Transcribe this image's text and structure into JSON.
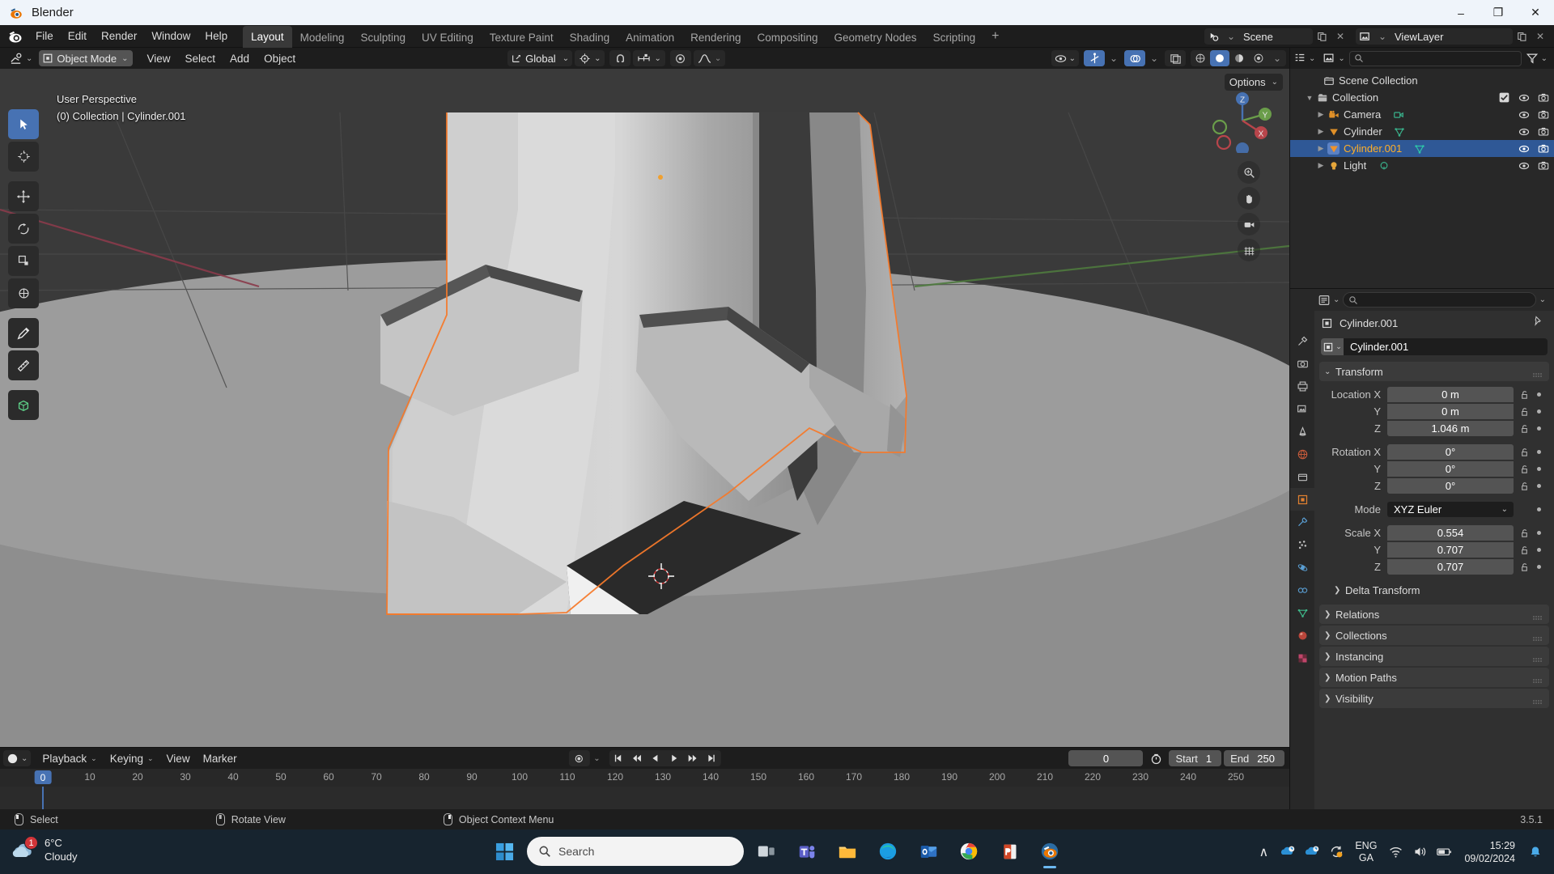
{
  "window": {
    "title": "Blender",
    "app_icon": "blender-logo-icon",
    "minimize": "–",
    "maximize": "❐",
    "close": "✕"
  },
  "topbar": {
    "menus": [
      "File",
      "Edit",
      "Render",
      "Window",
      "Help"
    ],
    "workspaces": [
      {
        "label": "Layout",
        "active": true
      },
      {
        "label": "Modeling",
        "active": false
      },
      {
        "label": "Sculpting",
        "active": false
      },
      {
        "label": "UV Editing",
        "active": false
      },
      {
        "label": "Texture Paint",
        "active": false
      },
      {
        "label": "Shading",
        "active": false
      },
      {
        "label": "Animation",
        "active": false
      },
      {
        "label": "Rendering",
        "active": false
      },
      {
        "label": "Compositing",
        "active": false
      },
      {
        "label": "Geometry Nodes",
        "active": false
      },
      {
        "label": "Scripting",
        "active": false
      }
    ],
    "add_workspace": "+",
    "scene_name": "Scene",
    "view_layer_name": "ViewLayer",
    "new_scene_icon": "duplicate-icon",
    "remove_scene_icon": "close-icon",
    "new_layer_icon": "duplicate-icon",
    "remove_layer_icon": "close-icon"
  },
  "viewport": {
    "mode": "Object Mode",
    "menus": [
      "View",
      "Select",
      "Add",
      "Object"
    ],
    "transform_orientation": "Global",
    "snap_icon": "magnet-icon",
    "proportional_icon": "proportional-editing-icon",
    "options_label": "Options",
    "overlay_line1": "User Perspective",
    "overlay_line2": "(0) Collection | Cylinder.001",
    "tools": [
      {
        "name": "tweak-tool",
        "active": true
      },
      {
        "name": "cursor-tool",
        "active": false
      },
      {
        "name": "move-tool",
        "active": false
      },
      {
        "name": "rotate-tool",
        "active": false
      },
      {
        "name": "scale-tool",
        "active": false
      },
      {
        "name": "transform-tool",
        "active": false
      },
      {
        "name": "annotate-tool",
        "active": false
      },
      {
        "name": "measure-tool",
        "active": false
      },
      {
        "name": "add-cube-tool",
        "active": false
      }
    ],
    "gizmo_axes": [
      "X",
      "Y",
      "Z"
    ],
    "nav_buttons": [
      "zoom-icon",
      "pan-hand-icon",
      "camera-view-icon",
      "toggle-ortho-icon"
    ],
    "shading_modes": [
      "wireframe",
      "solid",
      "material",
      "rendered"
    ],
    "active_shading": "solid"
  },
  "outliner": {
    "display_mode_icon": "outliner-icon",
    "filter_icon": "funnel-icon",
    "search_placeholder": "",
    "rows": [
      {
        "name": "Scene Collection",
        "icon": "scene-collection-icon",
        "indent": 0,
        "disclosure": "",
        "selected": false,
        "checkbox": false,
        "eye": false,
        "camera": false
      },
      {
        "name": "Collection",
        "icon": "collection-icon",
        "indent": 1,
        "disclosure": "▼",
        "selected": false,
        "checkbox": true,
        "eye": true,
        "camera": true
      },
      {
        "name": "Camera",
        "icon": "camera-data-icon",
        "indent": 2,
        "disclosure": "▶",
        "selected": false,
        "checkbox": false,
        "eye": true,
        "camera": true,
        "data_icon": "camera-object-icon"
      },
      {
        "name": "Cylinder",
        "icon": "mesh-data-icon",
        "indent": 2,
        "disclosure": "▶",
        "selected": false,
        "checkbox": false,
        "eye": true,
        "camera": true,
        "data_icon": "mesh-tri-icon"
      },
      {
        "name": "Cylinder.001",
        "icon": "mesh-data-icon",
        "indent": 2,
        "disclosure": "▶",
        "selected": true,
        "checkbox": false,
        "eye": true,
        "camera": true,
        "data_icon": "mesh-tri-icon"
      },
      {
        "name": "Light",
        "icon": "light-data-icon",
        "indent": 2,
        "disclosure": "▶",
        "selected": false,
        "checkbox": false,
        "eye": true,
        "camera": true,
        "data_icon": "light-bulb-icon"
      }
    ]
  },
  "properties": {
    "search_placeholder": "",
    "breadcrumb_object": "Cylinder.001",
    "pin_icon": "pin-icon",
    "object_name_field": "Cylinder.001",
    "tabs": [
      {
        "name": "tool-tab",
        "icon": "tool-icon",
        "active": false
      },
      {
        "name": "render-tab",
        "icon": "camera-back-icon",
        "active": false
      },
      {
        "name": "output-tab",
        "icon": "printer-icon",
        "active": false
      },
      {
        "name": "view-layer-tab",
        "icon": "images-icon",
        "active": false
      },
      {
        "name": "scene-tab",
        "icon": "cone-icon",
        "active": false
      },
      {
        "name": "world-tab",
        "icon": "globe-icon",
        "active": false
      },
      {
        "name": "collection-tab",
        "icon": "box-icon",
        "active": false
      },
      {
        "name": "object-tab",
        "icon": "square-orange-icon",
        "active": true
      },
      {
        "name": "modifiers-tab",
        "icon": "wrench-icon",
        "active": false
      },
      {
        "name": "particles-tab",
        "icon": "particles-icon",
        "active": false
      },
      {
        "name": "physics-tab",
        "icon": "physics-icon",
        "active": false
      },
      {
        "name": "constraints-tab",
        "icon": "constraint-icon",
        "active": false
      },
      {
        "name": "data-tab",
        "icon": "green-triangle-icon",
        "active": false
      },
      {
        "name": "material-tab",
        "icon": "material-sphere-icon",
        "active": false
      },
      {
        "name": "texture-tab",
        "icon": "checker-icon",
        "active": false
      }
    ],
    "transform_panel": {
      "title": "Transform",
      "groups": [
        {
          "label": "Location",
          "rows": [
            {
              "axis": "Location X",
              "value": "0 m"
            },
            {
              "axis": "Y",
              "value": "0 m"
            },
            {
              "axis": "Z",
              "value": "1.046 m"
            }
          ]
        },
        {
          "label": "Rotation",
          "rows": [
            {
              "axis": "Rotation X",
              "value": "0°"
            },
            {
              "axis": "Y",
              "value": "0°"
            },
            {
              "axis": "Z",
              "value": "0°"
            }
          ]
        }
      ],
      "mode_label": "Mode",
      "mode_value": "XYZ Euler",
      "scale_rows": [
        {
          "axis": "Scale X",
          "value": "0.554"
        },
        {
          "axis": "Y",
          "value": "0.707"
        },
        {
          "axis": "Z",
          "value": "0.707"
        }
      ],
      "delta_transform": "Delta Transform"
    },
    "collapsed_panels": [
      "Relations",
      "Collections",
      "Instancing",
      "Motion Paths",
      "Visibility"
    ]
  },
  "timeline": {
    "editor_icon": "timeline-icon",
    "menus": [
      "Playback",
      "Keying",
      "View",
      "Marker"
    ],
    "record_icon": "record-icon",
    "playback_buttons": [
      "jump-start-icon",
      "prev-keyframe-icon",
      "play-reverse-icon",
      "play-icon",
      "next-keyframe-icon",
      "jump-end-icon"
    ],
    "current_frame": "0",
    "use_preview_range_icon": "stopwatch-icon",
    "start_label": "Start",
    "start_value": "1",
    "end_label": "End",
    "end_value": "250",
    "ticks": [
      0,
      10,
      20,
      30,
      40,
      50,
      60,
      70,
      80,
      90,
      100,
      110,
      120,
      130,
      140,
      150,
      160,
      170,
      180,
      190,
      200,
      210,
      220,
      230,
      240,
      250
    ],
    "playhead_frame": 0
  },
  "statusbar": {
    "items": [
      {
        "icon": "mouse-left-icon",
        "label": "Select"
      },
      {
        "icon": "mouse-middle-icon",
        "label": "Rotate View"
      },
      {
        "icon": "mouse-right-icon",
        "label": "Object Context Menu"
      }
    ],
    "version": "3.5.1"
  },
  "taskbar": {
    "weather_temp": "6°C",
    "weather_desc": "Cloudy",
    "weather_badge": "1",
    "start_icon": "windows-logo-icon",
    "search_placeholder": "Search",
    "apps": [
      {
        "name": "task-view-icon",
        "active": false
      },
      {
        "name": "microsoft-teams-icon",
        "active": false
      },
      {
        "name": "file-explorer-icon",
        "active": false
      },
      {
        "name": "microsoft-edge-icon",
        "active": false
      },
      {
        "name": "outlook-icon",
        "active": false
      },
      {
        "name": "google-chrome-icon",
        "active": false
      },
      {
        "name": "powerpoint-icon",
        "active": false
      },
      {
        "name": "blender-taskbar-icon",
        "active": true
      }
    ],
    "tray_chevron": "∧",
    "tray_icons": [
      "onedrive-icon",
      "onedrive-icon",
      "update-icon"
    ],
    "lang_line1": "ENG",
    "lang_line2": "GA",
    "network_icon": "wifi-icon",
    "volume_icon": "speaker-icon",
    "battery_icon": "battery-icon",
    "time": "15:29",
    "date": "09/02/2024",
    "notification_icon": "bell-icon"
  },
  "colors": {
    "accent_blue": "#4772b3",
    "select_orange": "#ffaf29",
    "outliner_sel": "#2f5896",
    "panel_bg": "#303030",
    "header_bg": "#1d1d1d",
    "viewport_bg": "#3d3d3d",
    "taskbar_bg": "#17242f"
  }
}
